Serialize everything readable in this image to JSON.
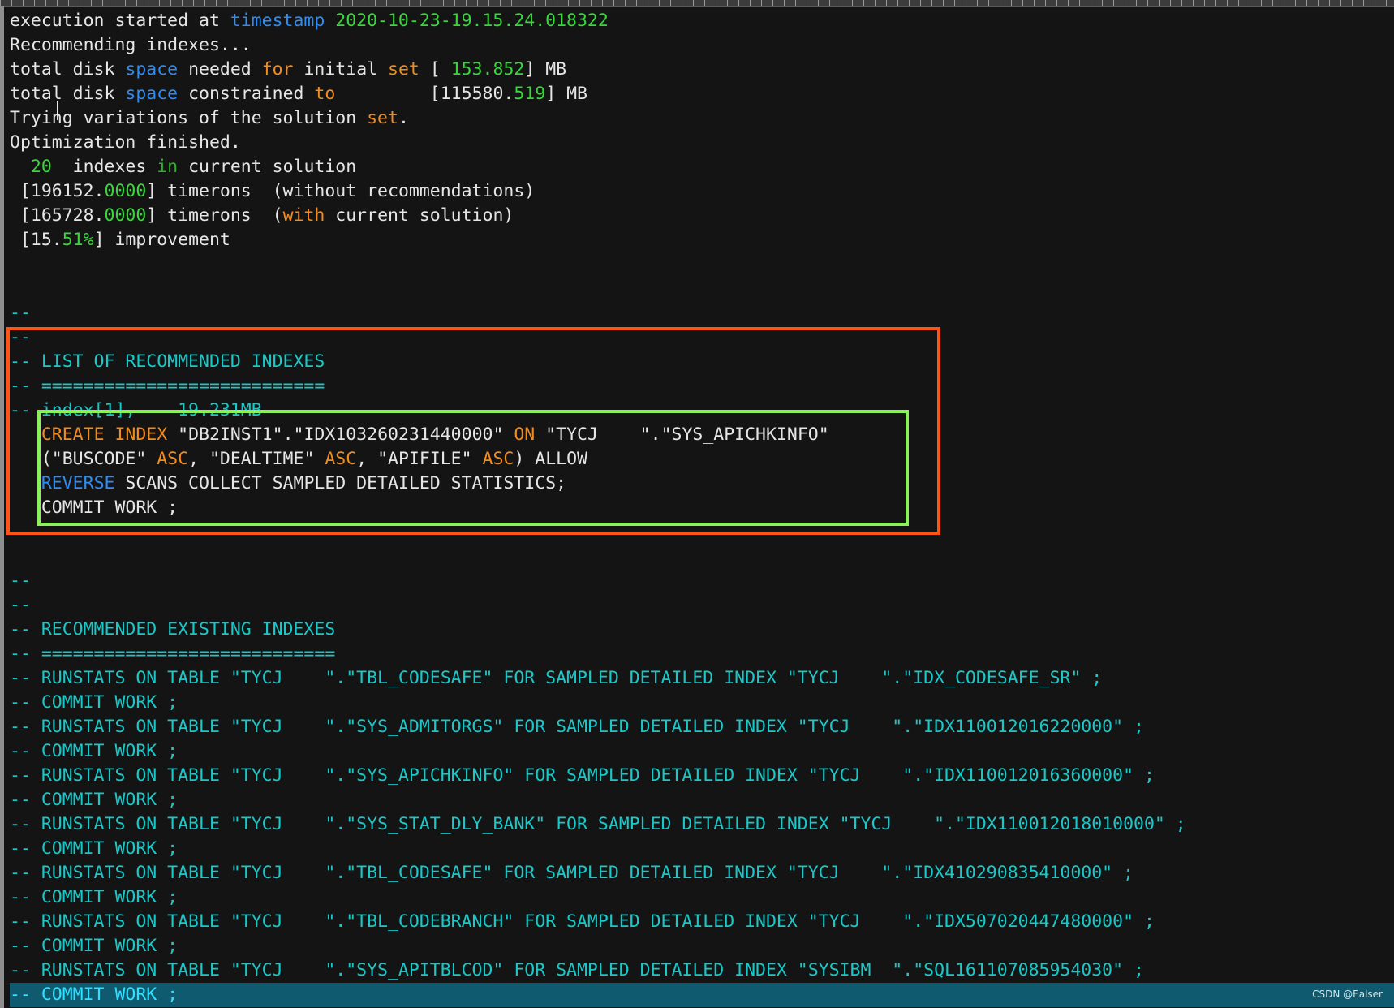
{
  "terminal": {
    "lines": [
      [
        {
          "t": "execution started at ",
          "c": "w"
        },
        {
          "t": "timestamp",
          "c": "kb"
        },
        {
          "t": " 2020-10-23-19.15.24.018322",
          "c": "g"
        }
      ],
      [
        {
          "t": "Recommending indexes...",
          "c": "w"
        }
      ],
      [
        {
          "t": "total disk ",
          "c": "w"
        },
        {
          "t": "space",
          "c": "kb"
        },
        {
          "t": " needed ",
          "c": "w"
        },
        {
          "t": "for",
          "c": "ko"
        },
        {
          "t": " initial ",
          "c": "w"
        },
        {
          "t": "set",
          "c": "ko"
        },
        {
          "t": " [ ",
          "c": "w"
        },
        {
          "t": "153.852",
          "c": "g"
        },
        {
          "t": "] MB",
          "c": "w"
        }
      ],
      [
        {
          "t": "total disk ",
          "c": "w"
        },
        {
          "t": "space",
          "c": "kb"
        },
        {
          "t": " constrained ",
          "c": "w"
        },
        {
          "t": "to",
          "c": "ko"
        },
        {
          "t": "         [115580.",
          "c": "w"
        },
        {
          "t": "519",
          "c": "g"
        },
        {
          "t": "] MB",
          "c": "w"
        }
      ],
      [
        {
          "t": "Trying variations of the solution ",
          "c": "w"
        },
        {
          "t": "set",
          "c": "ko"
        },
        {
          "t": ".",
          "c": "w"
        }
      ],
      [
        {
          "t": "Optimization finished.",
          "c": "w"
        }
      ],
      [
        {
          "t": "  ",
          "c": "w"
        },
        {
          "t": "20",
          "c": "g"
        },
        {
          "t": "  indexes ",
          "c": "w"
        },
        {
          "t": "in",
          "c": "dg"
        },
        {
          "t": " current solution",
          "c": "w"
        }
      ],
      [
        {
          "t": " [196152.",
          "c": "w"
        },
        {
          "t": "0000",
          "c": "g"
        },
        {
          "t": "] timerons  (without recommendations)",
          "c": "w"
        }
      ],
      [
        {
          "t": " [165728.",
          "c": "w"
        },
        {
          "t": "0000",
          "c": "g"
        },
        {
          "t": "] timerons  (",
          "c": "w"
        },
        {
          "t": "with",
          "c": "ko"
        },
        {
          "t": " current solution)",
          "c": "w"
        }
      ],
      [
        {
          "t": " [15.",
          "c": "w"
        },
        {
          "t": "51%",
          "c": "g"
        },
        {
          "t": "] improvement",
          "c": "w"
        }
      ],
      [],
      [],
      [
        {
          "t": "--",
          "c": "c"
        }
      ],
      [
        {
          "t": "--",
          "c": "c"
        }
      ],
      [
        {
          "t": "-- LIST OF RECOMMENDED INDEXES",
          "c": "c"
        }
      ],
      [
        {
          "t": "-- ===========================",
          "c": "c"
        }
      ],
      [
        {
          "t": "-- index[1],    19.231MB",
          "c": "c"
        }
      ],
      [
        {
          "t": "   ",
          "c": "w"
        },
        {
          "t": "CREATE INDEX",
          "c": "ko"
        },
        {
          "t": " \"DB2INST1\".\"IDX103260231440000\" ",
          "c": "w"
        },
        {
          "t": "ON",
          "c": "ko"
        },
        {
          "t": " \"TYCJ    \".\"SYS_APICHKINFO\"",
          "c": "w"
        }
      ],
      [
        {
          "t": "   (\"BUSCODE\" ",
          "c": "w"
        },
        {
          "t": "ASC",
          "c": "ko"
        },
        {
          "t": ", \"DEALTIME\" ",
          "c": "w"
        },
        {
          "t": "ASC",
          "c": "ko"
        },
        {
          "t": ", \"APIFILE\" ",
          "c": "w"
        },
        {
          "t": "ASC",
          "c": "ko"
        },
        {
          "t": ") ALLOW",
          "c": "w"
        }
      ],
      [
        {
          "t": "   ",
          "c": "w"
        },
        {
          "t": "REVERSE",
          "c": "kb"
        },
        {
          "t": " SCANS COLLECT SAMPLED DETAILED STATISTICS;",
          "c": "w"
        }
      ],
      [
        {
          "t": "   COMMIT WORK ;",
          "c": "w"
        }
      ],
      [],
      [],
      [
        {
          "t": "--",
          "c": "c"
        }
      ],
      [
        {
          "t": "--",
          "c": "c"
        }
      ],
      [
        {
          "t": "-- RECOMMENDED EXISTING INDEXES",
          "c": "c"
        }
      ],
      [
        {
          "t": "-- ============================",
          "c": "c"
        }
      ],
      [
        {
          "t": "-- RUNSTATS ON TABLE \"TYCJ    \".\"TBL_CODESAFE\" FOR SAMPLED DETAILED INDEX \"TYCJ    \".\"IDX_CODESAFE_SR\" ;",
          "c": "c"
        }
      ],
      [
        {
          "t": "-- COMMIT WORK ;",
          "c": "c"
        }
      ],
      [
        {
          "t": "-- RUNSTATS ON TABLE \"TYCJ    \".\"SYS_ADMITORGS\" FOR SAMPLED DETAILED INDEX \"TYCJ    \".\"IDX110012016220000\" ;",
          "c": "c"
        }
      ],
      [
        {
          "t": "-- COMMIT WORK ;",
          "c": "c"
        }
      ],
      [
        {
          "t": "-- RUNSTATS ON TABLE \"TYCJ    \".\"SYS_APICHKINFO\" FOR SAMPLED DETAILED INDEX \"TYCJ    \".\"IDX110012016360000\" ;",
          "c": "c"
        }
      ],
      [
        {
          "t": "-- COMMIT WORK ;",
          "c": "c"
        }
      ],
      [
        {
          "t": "-- RUNSTATS ON TABLE \"TYCJ    \".\"SYS_STAT_DLY_BANK\" FOR SAMPLED DETAILED INDEX \"TYCJ    \".\"IDX110012018010000\" ;",
          "c": "c"
        }
      ],
      [
        {
          "t": "-- COMMIT WORK ;",
          "c": "c"
        }
      ],
      [
        {
          "t": "-- RUNSTATS ON TABLE \"TYCJ    \".\"TBL_CODESAFE\" FOR SAMPLED DETAILED INDEX \"TYCJ    \".\"IDX410290835410000\" ;",
          "c": "c"
        }
      ],
      [
        {
          "t": "-- COMMIT WORK ;",
          "c": "c"
        }
      ],
      [
        {
          "t": "-- RUNSTATS ON TABLE \"TYCJ    \".\"TBL_CODEBRANCH\" FOR SAMPLED DETAILED INDEX \"TYCJ    \".\"IDX507020447480000\" ;",
          "c": "c"
        }
      ],
      [
        {
          "t": "-- COMMIT WORK ;",
          "c": "c"
        }
      ],
      [
        {
          "t": "-- RUNSTATS ON TABLE \"TYCJ    \".\"SYS_APITBLCOD\" FOR SAMPLED DETAILED INDEX \"SYSIBM  \".\"SQL161107085954030\" ;",
          "c": "c"
        }
      ],
      [
        {
          "t": "-- COMMIT WORK ;",
          "c": "c"
        }
      ]
    ],
    "highlight_line_index": 40
  },
  "colors": {
    "background": "#141414",
    "text": "#e6e6e6",
    "keyword_blue": "#2f8cf0",
    "keyword_orange": "#f48c1c",
    "number_green": "#39d63c",
    "comment_cyan": "#19c8c8",
    "annotation_orange_box": "#ff5416",
    "annotation_green_box": "#8cf05a"
  },
  "watermark": "CSDN @Ealser"
}
